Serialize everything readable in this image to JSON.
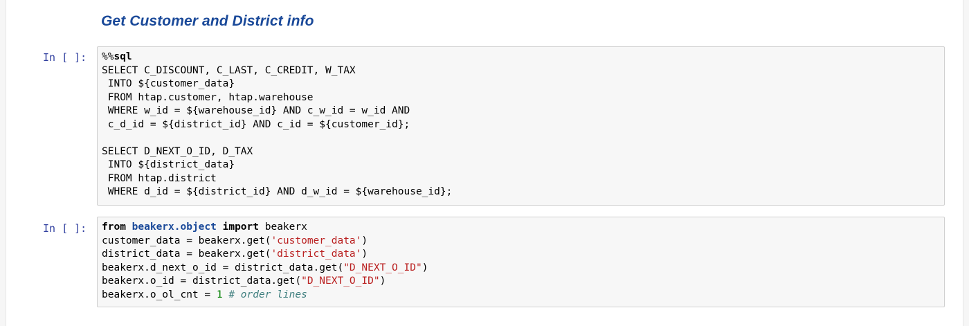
{
  "markdown": {
    "heading": "Get Customer and District info"
  },
  "cells": [
    {
      "prompt": "In [ ]:",
      "lines": [
        [
          {
            "t": "%%",
            "c": "op"
          },
          {
            "t": "sql",
            "c": "kw"
          }
        ],
        [
          {
            "t": "SELECT C_DISCOUNT, C_LAST, C_CREDIT, W_TAX",
            "c": ""
          }
        ],
        [
          {
            "t": " INTO ${customer_data}",
            "c": ""
          }
        ],
        [
          {
            "t": " FROM htap.customer, htap.warehouse",
            "c": ""
          }
        ],
        [
          {
            "t": " WHERE w_id = ${warehouse_id} AND c_w_id = w_id AND",
            "c": ""
          }
        ],
        [
          {
            "t": " c_d_id = ${district_id} AND c_id = ${customer_id};",
            "c": ""
          }
        ],
        [
          {
            "t": "",
            "c": ""
          }
        ],
        [
          {
            "t": "SELECT D_NEXT_O_ID, D_TAX",
            "c": ""
          }
        ],
        [
          {
            "t": " INTO ${district_data}",
            "c": ""
          }
        ],
        [
          {
            "t": " FROM htap.district",
            "c": ""
          }
        ],
        [
          {
            "t": " WHERE d_id = ${district_id} AND d_w_id = ${warehouse_id};",
            "c": ""
          }
        ]
      ]
    },
    {
      "prompt": "In [ ]:",
      "lines": [
        [
          {
            "t": "from",
            "c": "kw"
          },
          {
            "t": " ",
            "c": ""
          },
          {
            "t": "beakerx.object",
            "c": "nn"
          },
          {
            "t": " ",
            "c": ""
          },
          {
            "t": "import",
            "c": "kw"
          },
          {
            "t": " beakerx",
            "c": ""
          }
        ],
        [
          {
            "t": "customer_data = beakerx.get(",
            "c": ""
          },
          {
            "t": "'customer_data'",
            "c": "str"
          },
          {
            "t": ")",
            "c": ""
          }
        ],
        [
          {
            "t": "district_data = beakerx.get(",
            "c": ""
          },
          {
            "t": "'district_data'",
            "c": "str"
          },
          {
            "t": ")",
            "c": ""
          }
        ],
        [
          {
            "t": "beakerx.d_next_o_id = district_data.get(",
            "c": ""
          },
          {
            "t": "\"D_NEXT_O_ID\"",
            "c": "str"
          },
          {
            "t": ")",
            "c": ""
          }
        ],
        [
          {
            "t": "beakerx.o_id = district_data.get(",
            "c": ""
          },
          {
            "t": "\"D_NEXT_O_ID\"",
            "c": "str"
          },
          {
            "t": ")",
            "c": ""
          }
        ],
        [
          {
            "t": "beakerx.o_ol_cnt = ",
            "c": ""
          },
          {
            "t": "1",
            "c": "num"
          },
          {
            "t": " ",
            "c": ""
          },
          {
            "t": "# order lines",
            "c": "cm"
          }
        ]
      ]
    }
  ]
}
